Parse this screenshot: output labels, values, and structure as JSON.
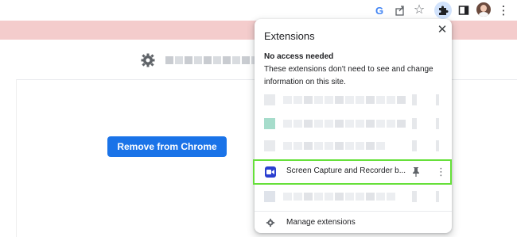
{
  "toolbar": {
    "icons": [
      "google-icon",
      "share-icon",
      "bookmark-star-icon",
      "extensions-puzzle-icon",
      "side-panel-icon",
      "profile-avatar",
      "more-menu-icon"
    ],
    "google_glyph": "G",
    "star_glyph": "☆",
    "menu_glyph": "⋮"
  },
  "page": {
    "button_label": "Remove from Chrome",
    "accent_color": "#1a73e8"
  },
  "extensions_popup": {
    "title": "Extensions",
    "close_glyph": "✕",
    "section_heading": "No access needed",
    "section_description": "These extensions don't need to see and change information on this site.",
    "highlighted_extension": {
      "name": "Screen Capture and Recorder b...",
      "menu_glyph": "⋮",
      "highlight_color": "#66e03a"
    },
    "manage_label": "Manage extensions"
  }
}
